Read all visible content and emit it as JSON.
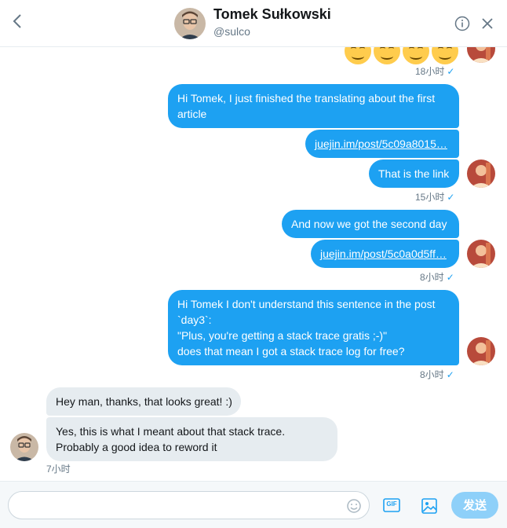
{
  "header": {
    "back_icon": "chevron-left-icon",
    "name": "Tomek Sułkowski",
    "handle": "@sulco",
    "info_icon": "info-icon",
    "close_icon": "close-icon"
  },
  "messages": [
    {
      "type": "emoji-row",
      "emojis": [
        "rolling-on-floor-laughing",
        "smiling-face",
        "smiling-face",
        "smiling-face"
      ],
      "time": "18小时",
      "status": "✓"
    },
    {
      "type": "out",
      "lines": [
        "Hi Tomek, I just finished the translating about the first",
        "article"
      ]
    },
    {
      "type": "out-link",
      "text": "juejin.im/post/5c09a8015…"
    },
    {
      "type": "out",
      "lines": [
        "That is the link"
      ],
      "time": "15小时",
      "status": "✓"
    },
    {
      "type": "out",
      "lines": [
        "And now we got the second day"
      ]
    },
    {
      "type": "out-link",
      "text": "juejin.im/post/5c0a0d5ff…",
      "time": "8小时",
      "status": "✓"
    },
    {
      "type": "out",
      "lines": [
        "Hi Tomek  I don't understand this sentence in the post",
        "`day3`:",
        "\"Plus, you're getting a stack trace gratis ;-)\"",
        "does that mean I got a stack trace log for free?"
      ],
      "time": "8小时",
      "status": "✓"
    },
    {
      "type": "in",
      "lines": [
        "Hey man, thanks, that looks great! :)"
      ]
    },
    {
      "type": "in",
      "lines": [
        "Yes, this is what I meant about that stack trace.",
        "Probably a good idea to reword it"
      ],
      "time": "7小时"
    }
  ],
  "composer": {
    "placeholder": "",
    "emoji_icon": "smiley-icon",
    "gif_label": "GIF",
    "image_icon": "image-icon",
    "send_label": "发送"
  },
  "colors": {
    "accent": "#1da1f2",
    "incoming_bubble": "#e6ecf0",
    "send_disabled": "#8ed0f9"
  }
}
